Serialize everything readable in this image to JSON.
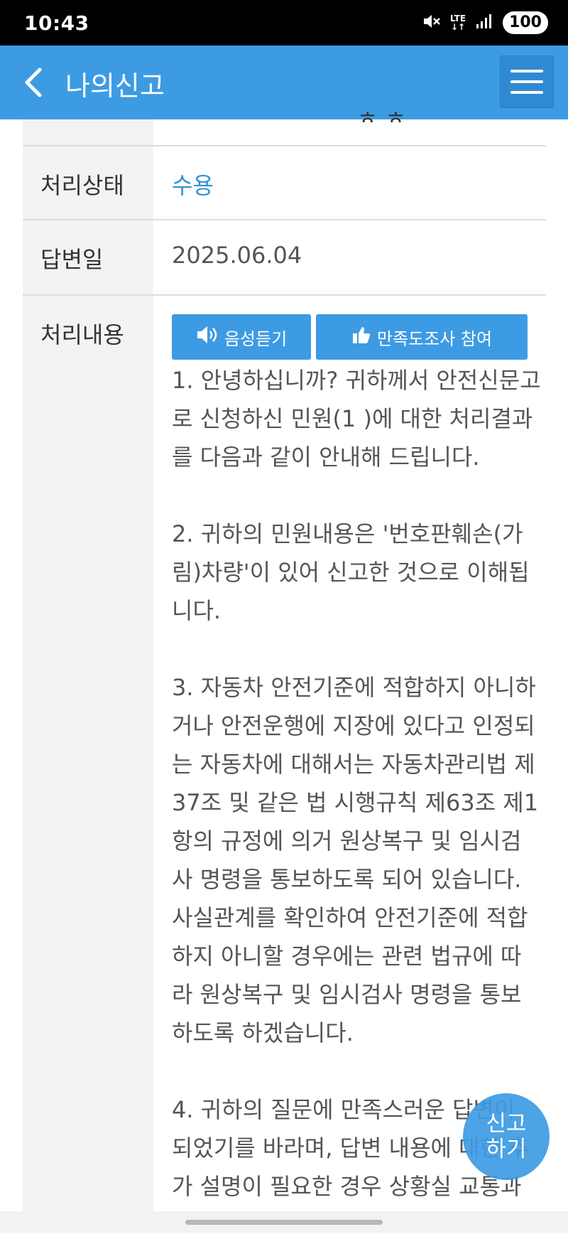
{
  "status_bar": {
    "time": "10:43",
    "network": "LTE",
    "battery": "100",
    "icons": [
      "mute-icon",
      "lte-icon",
      "signal-icon"
    ]
  },
  "header": {
    "title": "나의신고",
    "back_icon": "chevron-left-icon",
    "menu_icon": "hamburger-menu-icon",
    "background_color": "#3d9be3"
  },
  "details": {
    "rows": [
      {
        "label": "처리상태",
        "value": "수용"
      },
      {
        "label": "답변일",
        "value": "2025.06.04"
      },
      {
        "label": "처리내용",
        "value": ""
      }
    ],
    "status_color": "#3391d6"
  },
  "actions": {
    "voice_label": "음성듣기",
    "voice_icon": "speaker-icon",
    "survey_label": "만족도조사 참여",
    "survey_icon": "thumbs-up-icon"
  },
  "answer": {
    "p1_a": "1. 안녕하십니까? 귀하께서 안전신문고로 신청하신 민원(1",
    "p1_redacted": "                    ",
    "p1_b": ")에 대한 처리결과를 다음과 같이 안내해 드립니다.",
    "p2": "2. 귀하의 민원내용은 '번호판훼손(가림)차량'이 있어 신고한 것으로 이해됩니다.",
    "p3": "3. 자동차 안전기준에 적합하지 아니하거나 안전운행에 지장에 있다고 인정되는 자동차에 대해서는 자동차관리법 제37조 및 같은 법 시행규칙 제63조 제1항의 규정에 의거 원상복구 및 임시검사 명령을 통보하도록 되어 있습니다. 사실관계를 확인하여 안전기준에 적합하지 아니할 경우에는 관련 법규에 따라 원상복구 및 임시검사 명령을 통보하도록 하겠습니다.",
    "p4": "4. 귀하의 질문에 만족스러운 답변이 되었기를 바라며, 답변 내용에 대한 추가 설명이 필요한 경우 상황실 교통과"
  },
  "fab": {
    "line1": "신고",
    "line2": "하기"
  }
}
